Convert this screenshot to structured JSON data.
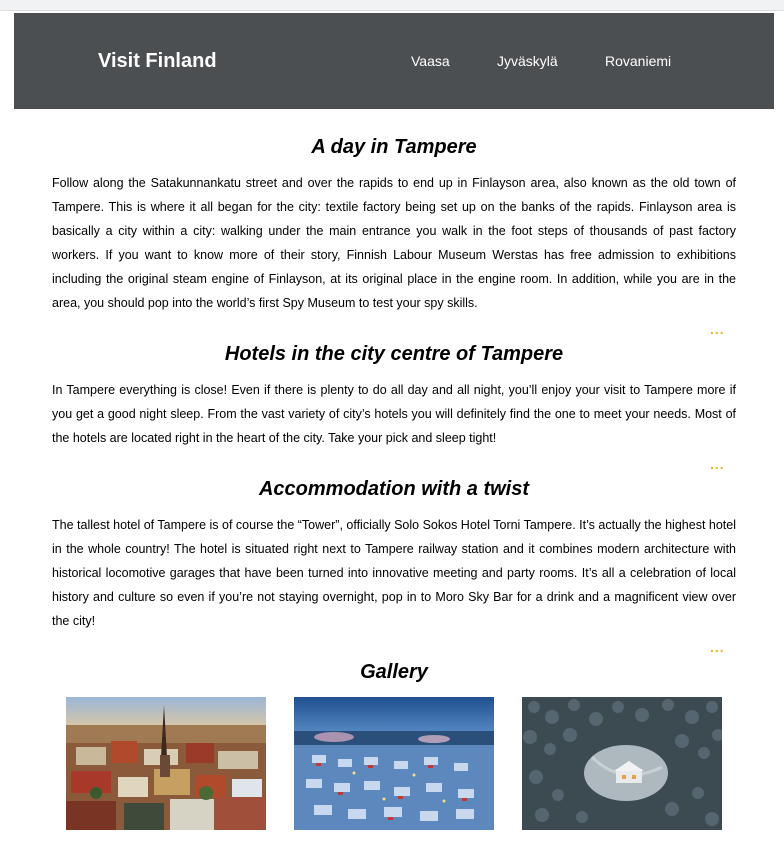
{
  "header": {
    "brand": "Visit Finland",
    "nav": [
      "Vaasa",
      "Jyväskylä",
      "Rovaniemi"
    ]
  },
  "sections": [
    {
      "title": "A day in Tampere",
      "body": "Follow along the Satakunnankatu street and over the rapids to end up in Finlayson area, also known as the old town of Tampere. This is where it all began for the city: textile factory being set up on the banks of the rapids. Finlayson area is basically a city within a city: walking under the main entrance you walk in the foot steps of thousands of past factory workers. If you want to know more of their story, Finnish Labour Museum Werstas has free admission to exhibitions including the original steam engine of Finlayson, at its original place in the engine room. In addition, while you are in the area, you should pop into the world’s first Spy Museum to test your spy skills.",
      "more": "..."
    },
    {
      "title": "Hotels in the city centre of Tampere",
      "body": "In Tampere everything is close! Even if there is plenty to do all day and all night, you’ll enjoy your visit to Tampere more if you get a good night sleep. From the vast variety of city’s hotels you will definitely find the one to meet your needs. Most of the hotels are located right in the heart of the city. Take your pick and sleep tight!",
      "more": "..."
    },
    {
      "title": "Accommodation with a twist",
      "body": "The tallest hotel of Tampere is of course the “Tower”, officially Solo Sokos Hotel Torni Tampere. It’s actually the highest hotel in the whole country! The hotel is situated right next to Tampere railway station and it combines modern architecture with historical locomotive garages that have been turned into innovative meeting and party rooms. It’s all a celebration of local history and culture so even if you’re not staying overnight, pop in to Moro Sky Bar for a drink and a magnificent view over the city!",
      "more": "..."
    }
  ],
  "gallery": {
    "title": "Gallery",
    "images": [
      "aerial-city-photo",
      "snowy-village-photo",
      "forest-cabin-photo"
    ]
  },
  "colors": {
    "header_bg": "#4c4f51",
    "header_text": "#ffffff",
    "accent_dots": "#e2b92c"
  }
}
